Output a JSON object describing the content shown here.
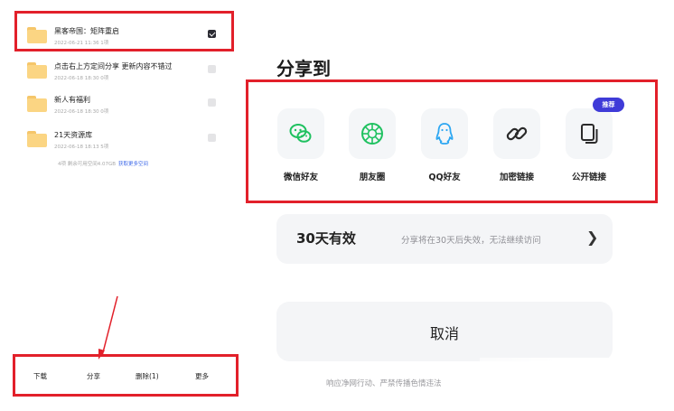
{
  "files": [
    {
      "name": "黑客帝国：矩阵重启",
      "meta": "2022-06-21 11:36  1项",
      "checked": true
    },
    {
      "name": "点击右上方定间分享 更新内容不错过",
      "meta": "2022-06-18 18:30  0项",
      "checked": false
    },
    {
      "name": "新人有福利",
      "meta": "2022-06-18 18:30  0项",
      "checked": false
    },
    {
      "name": "21天资源库",
      "meta": "2022-06-18 18:13  5项",
      "checked": false
    }
  ],
  "storage": {
    "text": "4项  剩余可用空间4.07GB",
    "link": "获取更多空间"
  },
  "bottom_bar": {
    "download": "下载",
    "share": "分享",
    "delete": "删除(1)",
    "more": "更多"
  },
  "share": {
    "title": "分享到",
    "badge": "推荐",
    "options": [
      {
        "label": "微信好友",
        "icon": "wechat-icon",
        "color": "#1fc160"
      },
      {
        "label": "朋友圈",
        "icon": "moments-icon",
        "color": "#1fc160"
      },
      {
        "label": "QQ好友",
        "icon": "qq-icon",
        "color": "#2da7f2"
      },
      {
        "label": "加密链接",
        "icon": "link-icon",
        "color": "#2b2b2b"
      },
      {
        "label": "公开链接",
        "icon": "copy-icon",
        "color": "#2b2b2b"
      }
    ],
    "validity": {
      "label": "30天有效",
      "hint": "分享将在30天后失效，无法继续访问",
      "arrow": "❯"
    },
    "cancel": "取消",
    "footer": "响应净网行动、严禁传播色情违法"
  },
  "colors": {
    "annotation_red": "#e2202a",
    "accent": "#3f3bd8",
    "link_blue": "#3d68e8"
  }
}
